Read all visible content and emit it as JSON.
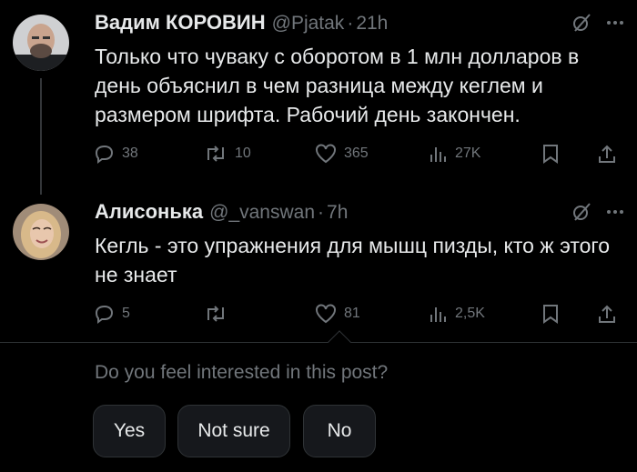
{
  "tweets": [
    {
      "name": "Вадим КОРОВИН",
      "handle": "@Pjatak",
      "dot": "·",
      "time": "21h",
      "text": "Только что чуваку с оборотом в 1 млн долларов в день объяснил в чем разница между кеглем и размером шрифта.  Рабочий день закончен.",
      "replies": "38",
      "reposts": "10",
      "likes": "365",
      "views": "27K"
    },
    {
      "name": "Алисонька",
      "handle": "@_vanswan",
      "dot": "·",
      "time": "7h",
      "text": "Кегль - это упражнения для мышц пизды, кто ж этого не знает",
      "replies": "5",
      "reposts": "",
      "likes": "81",
      "views": "2,5K"
    }
  ],
  "feedback": {
    "question": "Do you feel interested in this post?",
    "options": [
      "Yes",
      "Not sure",
      "No"
    ]
  },
  "icons": {
    "grok": "grok-slash-icon",
    "more": "more-icon",
    "reply": "reply-icon",
    "repost": "repost-icon",
    "like": "like-icon",
    "views": "views-icon",
    "bookmark": "bookmark-icon",
    "share": "share-icon"
  },
  "colors": {
    "background": "#000000",
    "text": "#e7e9ea",
    "muted": "#71767b",
    "border": "#2f3336",
    "button_bg": "#16181c"
  }
}
